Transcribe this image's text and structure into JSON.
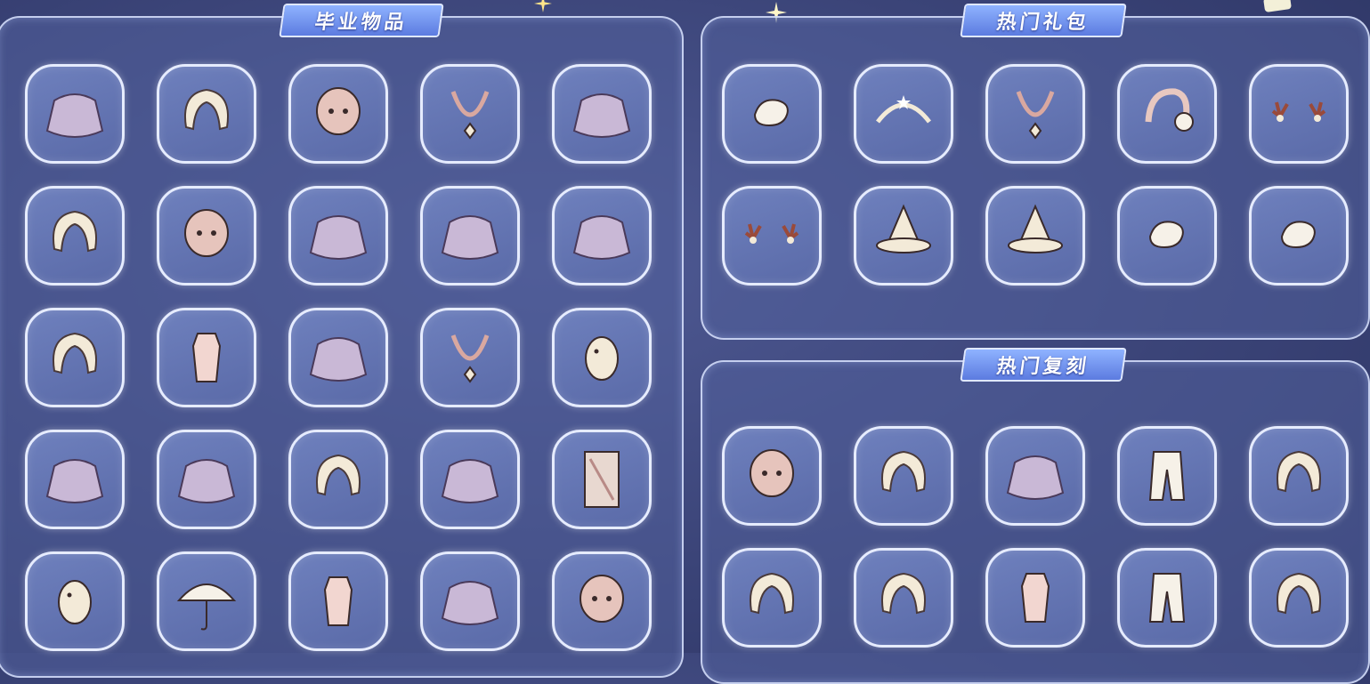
{
  "sections": {
    "graduation": {
      "title": "毕业物品"
    },
    "hot_gifts": {
      "title": "热门礼包"
    },
    "hot_reruns": {
      "title": "热门复刻"
    }
  },
  "graduation_items": [
    "cape-icon",
    "hair-icon",
    "mask-icon",
    "necklace-icon",
    "cape-icon",
    "hair-icon",
    "mask-icon",
    "cape-icon",
    "cape-icon",
    "cape-icon",
    "hair-icon",
    "outfit-icon",
    "cape-icon",
    "necklace-icon",
    "prop-icon",
    "cape-icon",
    "cape-icon",
    "hair-icon",
    "cape-icon",
    "card-icon",
    "prop-icon",
    "umbrella-icon",
    "outfit-icon",
    "cape-icon",
    "mask-icon"
  ],
  "hot_gift_items": [
    "hair-accessory-icon",
    "headband-icon",
    "necklace-icon",
    "earmuff-icon",
    "horns-icon",
    "horns-icon",
    "hat-icon",
    "hat-icon",
    "hair-accessory-icon",
    "hair-accessory-icon"
  ],
  "hot_rerun_items": [
    "mask-icon",
    "hair-icon",
    "cape-icon",
    "pants-icon",
    "hair-icon",
    "hair-icon",
    "hair-icon",
    "outfit-icon",
    "pants-icon",
    "hair-icon"
  ],
  "colors": {
    "background": "#3b4478",
    "panel_border": "#dfe8ff",
    "title_badge": "#6f8ef0",
    "slot_fill": "#6a7bb8"
  }
}
